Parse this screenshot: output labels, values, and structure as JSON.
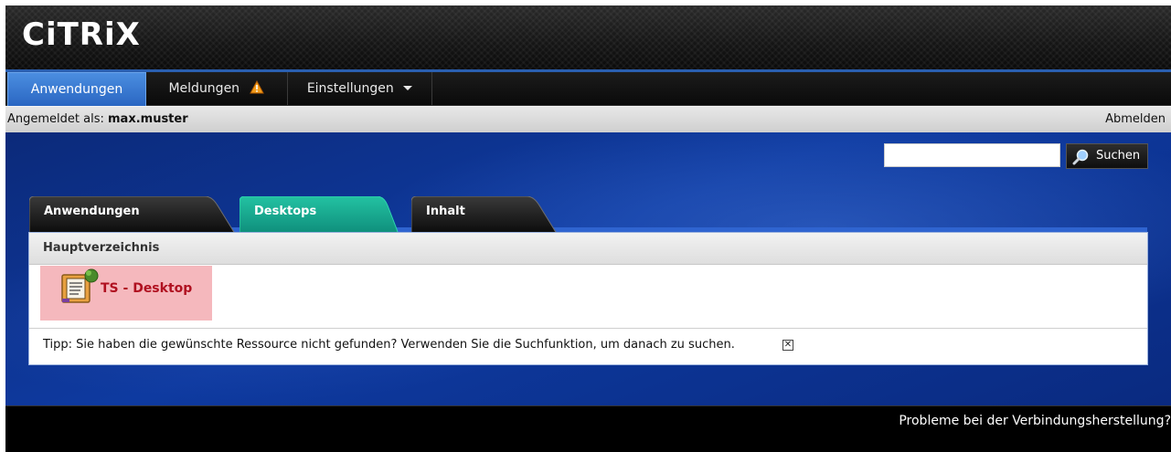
{
  "brand": {
    "logo_text": "CiTRiX"
  },
  "topnav": {
    "items": [
      {
        "label": "Anwendungen",
        "active": true
      },
      {
        "label": "Meldungen",
        "icon": "warning-icon"
      },
      {
        "label": "Einstellungen",
        "icon": "caret-down-icon"
      }
    ]
  },
  "userbar": {
    "prefix": "Angemeldet als: ",
    "username": "max.muster",
    "logout_label": "Abmelden"
  },
  "search": {
    "value": "",
    "button_label": "Suchen",
    "button_icon": "magnifier-icon"
  },
  "tabs": [
    {
      "label": "Anwendungen",
      "active": false
    },
    {
      "label": "Desktops",
      "active": true
    },
    {
      "label": "Inhalt",
      "active": false
    }
  ],
  "panel": {
    "header": "Hauptverzeichnis",
    "resources": [
      {
        "label": "TS - Desktop",
        "icon": "desktop-resource-icon"
      }
    ],
    "tip": "Tipp: Sie haben die gewünschte Ressource nicht gefunden? Verwenden Sie die Suchfunktion, um danach zu suchen.",
    "tip_close": "✕"
  },
  "footer": {
    "help_link": "Probleme bei der Verbindungsherstellung?"
  },
  "colors": {
    "nav_active": "#2a66c2",
    "tab_active": "#12a08a",
    "main_bg": "#0e3aa0",
    "resource_highlight": "#f5b8bd"
  }
}
